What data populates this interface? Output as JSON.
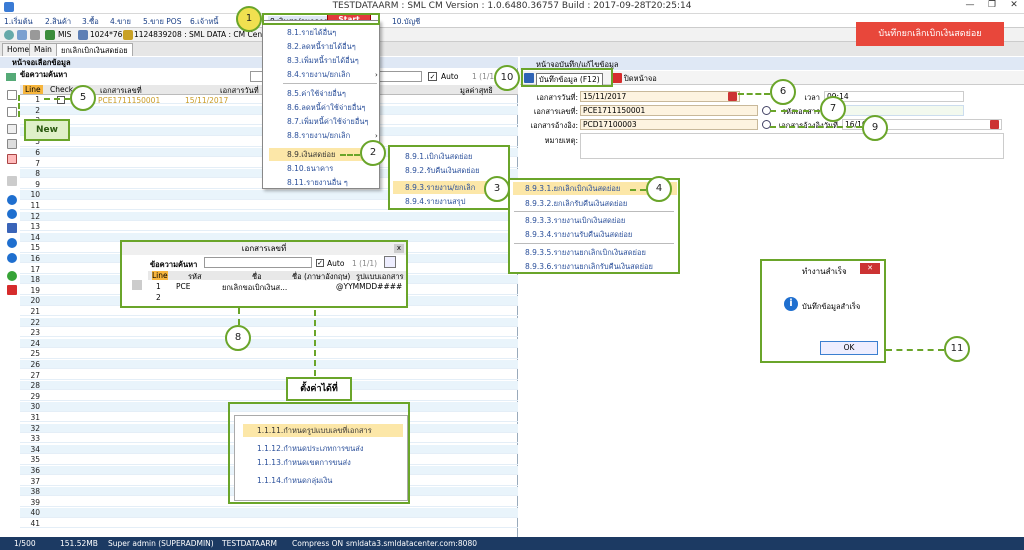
{
  "window": {
    "title": "TESTDATAARM : SML CM Version : 1.0.6480.36757  Build : 2017-09-28T20:25:14",
    "min": "—",
    "max": "❐",
    "close": "✕"
  },
  "menubar": [
    "1.เริ่มต้น",
    "2.สินค้า",
    "3.ซื้อ",
    "4.ขาย",
    "5.ขาย POS",
    "6.เจ้าหนี้",
    "8.เงินสด/ธนาคาร",
    "10.บัญชี"
  ],
  "start_label": "Start",
  "toolbar": {
    "mis": "MIS",
    "res": "1024*768",
    "server": "1124839208 : SML DATA : CM Center"
  },
  "tabs": [
    "Home",
    "Main",
    "ยกเลิกเบิกเงินสดย่อย"
  ],
  "save_banner": "บันทึกยกเลิกเบิกเงินสดย่อย",
  "left": {
    "header": "หน้าจอเลือกข้อมูล",
    "search_label": "ข้อความค้นหา",
    "auto": "Auto",
    "page": "1 (1/1)",
    "columns": [
      "Line",
      "Check",
      "เอกสารเลขที่",
      "เอกสารวันที่",
      "มูลค่าสุทธิ"
    ],
    "row1": {
      "doc": "PCE1711150001",
      "date": "15/11/2017"
    },
    "new_label": "New",
    "lines": [
      "1",
      "2",
      "3",
      "4",
      "5",
      "6",
      "7",
      "8",
      "9",
      "10",
      "11",
      "12",
      "13",
      "14",
      "15",
      "16",
      "17",
      "18",
      "19",
      "20",
      "21",
      "22",
      "23",
      "24",
      "25",
      "26",
      "27",
      "28",
      "29",
      "30",
      "31",
      "32",
      "33",
      "34",
      "35",
      "36",
      "37",
      "38",
      "39",
      "40",
      "41"
    ]
  },
  "right": {
    "header": "หน้าจอบันทึก/แก้ไขข้อมูล",
    "save_btn": "บันทึกข้อมูล (F12)",
    "close_btn": "ปิดหน้าจอ",
    "date_label": "เอกสารวันที่:",
    "date_value": "15/11/2017",
    "time_label": "เวลา",
    "time_value": "09:14",
    "doc_label": "เอกสารเลขที่:",
    "doc_value": "PCE1711150001",
    "code_label": "รหัสเอกสาร",
    "code_value": "PCE",
    "ref_label": "เอกสารอ้างอิง:",
    "ref_value": "PCD17100003",
    "refdate_label": "เอกสารอ้างอิงวันที่",
    "refdate_value": "16/10",
    "note_label": "หมายเหตุ:"
  },
  "menu1": [
    "8.1.รายได้อื่นๆ",
    "8.2.ลดหนี้รายได้อื่นๆ",
    "8.3.เพิ่มหนี้รายได้อื่นๆ",
    "8.4.รายงาน/ยกเลิก",
    "8.5.ค่าใช้จ่ายอื่นๆ",
    "8.6.ลดหนี้ค่าใช้จ่ายอื่นๆ",
    "8.7.เพิ่มหนี้ค่าใช้จ่ายอื่นๆ",
    "8.8.รายงาน/ยกเลิก",
    "8.9.เงินสดย่อย",
    "8.10.ธนาคาร",
    "8.11.รายงานอื่น ๆ"
  ],
  "menu2": [
    "8.9.1.เบิกเงินสดย่อย",
    "8.9.2.รับคืนเงินสดย่อย",
    "8.9.3.รายงาน/ยกเลิก",
    "8.9.4.รายงานสรุป"
  ],
  "menu3": [
    "8.9.3.1.ยกเลิกเบิกเงินสดย่อย",
    "8.9.3.2.ยกเลิกรับคืนเงินสดย่อย",
    "8.9.3.3.รายงานเบิกเงินสดย่อย",
    "8.9.3.4.รายงานรับคืนเงินสดย่อย",
    "8.9.3.5.รายงานยกเลิกเบิกเงินสดย่อย",
    "8.9.3.6.รายงานยกเลิกรับคืนเงินสดย่อย"
  ],
  "doc_dialog": {
    "title": "เอกสารเลขที่",
    "close": "x",
    "search_label": "ข้อความค้นหา",
    "auto": "Auto",
    "page": "1 (1/1)",
    "columns": [
      "Line",
      "รหัส",
      "ชื่อ",
      "ชื่อ (ภาษาอังกฤษ)",
      "รูปแบบเอกสาร"
    ],
    "row1": {
      "line": "1",
      "code": "PCE",
      "name": "ยกเลิกขอเบิกเงินส...",
      "format": "@YYMMDD####"
    },
    "row2": {
      "line": "2"
    }
  },
  "settings_box": {
    "title": "ตั้งค่าได้ที่",
    "items": [
      "1.1.11.กำหนดรูปแบบเลขที่เอกสาร",
      "1.1.12.กำหนดประเภทการขนส่ง",
      "1.1.13.กำหนดเขตการขนส่ง",
      "1.1.14.กำหนดกลุ่มเงิน"
    ]
  },
  "ok_dialog": {
    "title": "ทำงานสำเร็จ",
    "close": "✕",
    "message": "บันทึกข้อมูลสำเร็จ",
    "ok": "OK"
  },
  "callouts": [
    "1",
    "2",
    "3",
    "4",
    "5",
    "6",
    "7",
    "8",
    "9",
    "10",
    "11"
  ],
  "status": {
    "page": "1/500",
    "mem": "151.52MB",
    "user": "Super admin (SUPERADMIN)",
    "db": "TESTDATAARM",
    "compress": "Compress ON",
    "server": "smldata3.smldatacenter.com:8080"
  },
  "colors": {
    "accent": "#6aa52a",
    "banner": "#e8473b",
    "status_bg": "#1c3a63",
    "highlight": "#fce7a8"
  }
}
